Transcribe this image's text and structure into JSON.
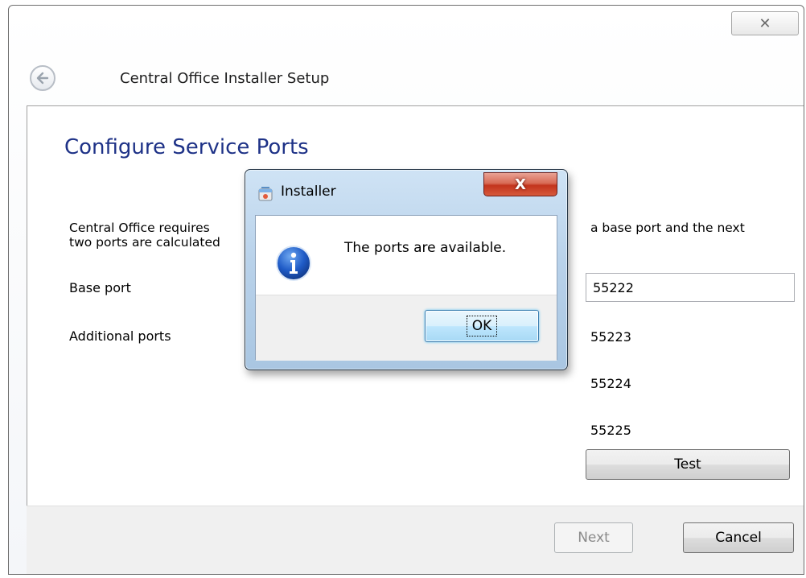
{
  "window": {
    "title": "Central Office Installer Setup",
    "close_glyph": "✕"
  },
  "page": {
    "heading": "Configure Service Ports",
    "description_line1": "Central Office requires",
    "description_line2": "two ports are calculated",
    "description_right": "a base port and the next",
    "base_port_label": "Base port",
    "base_port_value": "55222",
    "additional_ports_label": "Additional ports",
    "additional_ports": [
      "55223",
      "55224",
      "55225"
    ],
    "test_label": "Test"
  },
  "footer": {
    "next_label": "Next",
    "cancel_label": "Cancel"
  },
  "dialog": {
    "title": "Installer",
    "close_glyph": "X",
    "message": "The ports are available.",
    "ok_label": "OK"
  },
  "icons": {
    "back": "back-arrow-icon",
    "info": "info-icon",
    "installer": "installer-icon"
  }
}
